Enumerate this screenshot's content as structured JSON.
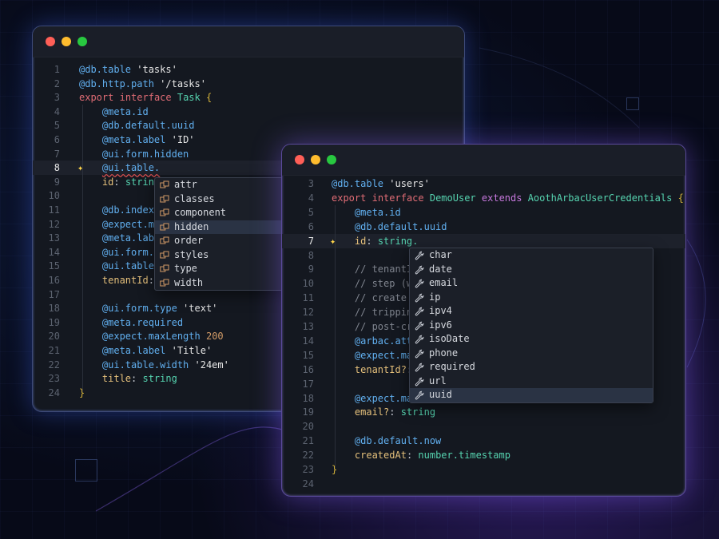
{
  "window1": {
    "lines": [
      {
        "n": "1",
        "segs": [
          [
            "dec",
            "@db.table"
          ],
          [
            "str",
            " 'tasks'"
          ]
        ]
      },
      {
        "n": "2",
        "segs": [
          [
            "dec",
            "@db.http.path"
          ],
          [
            "str",
            " '/tasks'"
          ]
        ]
      },
      {
        "n": "3",
        "segs": [
          [
            "kw",
            "export"
          ],
          [
            "pl",
            " "
          ],
          [
            "kw",
            "interface"
          ],
          [
            "pl",
            " "
          ],
          [
            "t",
            "Task"
          ],
          [
            "pl",
            " "
          ],
          [
            "br",
            "{"
          ]
        ]
      },
      {
        "n": "4",
        "segs": [
          [
            "pl",
            "    "
          ],
          [
            "dec",
            "@meta.id"
          ]
        ]
      },
      {
        "n": "5",
        "segs": [
          [
            "pl",
            "    "
          ],
          [
            "dec",
            "@db.default.uuid"
          ]
        ]
      },
      {
        "n": "6",
        "segs": [
          [
            "pl",
            "    "
          ],
          [
            "dec",
            "@meta.label"
          ],
          [
            "str",
            " 'ID'"
          ]
        ]
      },
      {
        "n": "7",
        "segs": [
          [
            "pl",
            "    "
          ],
          [
            "dec",
            "@ui.form.hidden"
          ]
        ]
      },
      {
        "n": "8",
        "cur": true,
        "spark": true,
        "segs": [
          [
            "pl",
            "    "
          ],
          [
            "dec squig",
            "@ui.table."
          ]
        ]
      },
      {
        "n": "9",
        "segs": [
          [
            "pl",
            "    "
          ],
          [
            "prop",
            "id"
          ],
          [
            "pl",
            ": "
          ],
          [
            "t",
            "string"
          ]
        ]
      },
      {
        "n": "10",
        "segs": []
      },
      {
        "n": "11",
        "segs": [
          [
            "pl",
            "    "
          ],
          [
            "dec",
            "@db.index.unique"
          ]
        ]
      },
      {
        "n": "12",
        "segs": [
          [
            "pl",
            "    "
          ],
          [
            "dec",
            "@expect.maxLength"
          ]
        ]
      },
      {
        "n": "13",
        "segs": [
          [
            "pl",
            "    "
          ],
          [
            "dec",
            "@meta.label"
          ]
        ]
      },
      {
        "n": "14",
        "segs": [
          [
            "pl",
            "    "
          ],
          [
            "dec",
            "@ui.form.hidden"
          ]
        ]
      },
      {
        "n": "15",
        "segs": [
          [
            "pl",
            "    "
          ],
          [
            "dec",
            "@ui.table.hidden"
          ]
        ]
      },
      {
        "n": "16",
        "segs": [
          [
            "pl",
            "    "
          ],
          [
            "prop",
            "tenantId"
          ],
          [
            "pl",
            ": "
          ],
          [
            "t",
            "string"
          ]
        ]
      },
      {
        "n": "17",
        "segs": []
      },
      {
        "n": "18",
        "segs": [
          [
            "pl",
            "    "
          ],
          [
            "dec",
            "@ui.form.type"
          ],
          [
            "str",
            " 'text'"
          ]
        ]
      },
      {
        "n": "19",
        "segs": [
          [
            "pl",
            "    "
          ],
          [
            "dec",
            "@meta.required"
          ]
        ]
      },
      {
        "n": "20",
        "segs": [
          [
            "pl",
            "    "
          ],
          [
            "dec",
            "@expect.maxLength"
          ],
          [
            "pl",
            " "
          ],
          [
            "num",
            "200"
          ]
        ]
      },
      {
        "n": "21",
        "segs": [
          [
            "pl",
            "    "
          ],
          [
            "dec",
            "@meta.label"
          ],
          [
            "str",
            " 'Title'"
          ]
        ]
      },
      {
        "n": "22",
        "segs": [
          [
            "pl",
            "    "
          ],
          [
            "dec",
            "@ui.table.width"
          ],
          [
            "str",
            " '24em'"
          ]
        ]
      },
      {
        "n": "23",
        "segs": [
          [
            "pl",
            "    "
          ],
          [
            "prop",
            "title"
          ],
          [
            "pl",
            ": "
          ],
          [
            "t",
            "string"
          ]
        ]
      },
      {
        "n": "24",
        "segs": [
          [
            "br",
            "}"
          ]
        ]
      }
    ],
    "autocomplete": {
      "icon": "symbol-method-icon",
      "items": [
        "attr",
        "classes",
        "component",
        "hidden",
        "order",
        "styles",
        "type",
        "width"
      ],
      "selected": 3
    }
  },
  "window2": {
    "lines": [
      {
        "n": "3",
        "segs": [
          [
            "dec",
            "@db.table"
          ],
          [
            "str",
            " 'users'"
          ]
        ]
      },
      {
        "n": "4",
        "segs": [
          [
            "kw",
            "export"
          ],
          [
            "pl",
            " "
          ],
          [
            "kw",
            "interface"
          ],
          [
            "pl",
            " "
          ],
          [
            "t",
            "DemoUser"
          ],
          [
            "pl",
            " "
          ],
          [
            "kw2",
            "extends"
          ],
          [
            "pl",
            " "
          ],
          [
            "t",
            "AoothArbacUserCredentials"
          ],
          [
            "pl",
            " "
          ],
          [
            "br",
            "{"
          ]
        ]
      },
      {
        "n": "5",
        "segs": [
          [
            "pl",
            "    "
          ],
          [
            "dec",
            "@meta.id"
          ]
        ]
      },
      {
        "n": "6",
        "segs": [
          [
            "pl",
            "    "
          ],
          [
            "dec",
            "@db.default.uuid"
          ]
        ]
      },
      {
        "n": "7",
        "cur": true,
        "spark": true,
        "segs": [
          [
            "pl",
            "    "
          ],
          [
            "prop",
            "id"
          ],
          [
            "pl",
            ": "
          ],
          [
            "t",
            "string."
          ]
        ]
      },
      {
        "n": "8",
        "segs": []
      },
      {
        "n": "9",
        "segs": [
          [
            "pl",
            "    "
          ],
          [
            "cm",
            "// tenantId"
          ]
        ]
      },
      {
        "n": "10",
        "segs": [
          [
            "pl",
            "    "
          ],
          [
            "cm",
            "// step (wh"
          ]
        ]
      },
      {
        "n": "11",
        "segs": [
          [
            "pl",
            "    "
          ],
          [
            "cm",
            "// create r"
          ]
        ]
      },
      {
        "n": "12",
        "segs": [
          [
            "pl",
            "    "
          ],
          [
            "cm",
            "// tripping"
          ]
        ]
      },
      {
        "n": "13",
        "segs": [
          [
            "pl",
            "    "
          ],
          [
            "cm",
            "// post-cre"
          ]
        ]
      },
      {
        "n": "14",
        "segs": [
          [
            "pl",
            "    "
          ],
          [
            "dec",
            "@arbac.attr"
          ]
        ]
      },
      {
        "n": "15",
        "segs": [
          [
            "pl",
            "    "
          ],
          [
            "dec",
            "@expect.max"
          ]
        ]
      },
      {
        "n": "16",
        "segs": [
          [
            "pl",
            "    "
          ],
          [
            "prop",
            "tenantId?"
          ],
          [
            "pl",
            ": "
          ]
        ]
      },
      {
        "n": "17",
        "segs": []
      },
      {
        "n": "18",
        "segs": [
          [
            "pl",
            "    "
          ],
          [
            "dec",
            "@expect.max"
          ]
        ]
      },
      {
        "n": "19",
        "segs": [
          [
            "pl",
            "    "
          ],
          [
            "prop",
            "email?"
          ],
          [
            "pl",
            ": "
          ],
          [
            "t",
            "string"
          ]
        ]
      },
      {
        "n": "20",
        "segs": []
      },
      {
        "n": "21",
        "segs": [
          [
            "pl",
            "    "
          ],
          [
            "dec",
            "@db.default.now"
          ]
        ]
      },
      {
        "n": "22",
        "segs": [
          [
            "pl",
            "    "
          ],
          [
            "prop",
            "createdAt"
          ],
          [
            "pl",
            ": "
          ],
          [
            "t",
            "number.timestamp"
          ]
        ]
      },
      {
        "n": "23",
        "segs": [
          [
            "br",
            "}"
          ]
        ]
      },
      {
        "n": "24",
        "segs": []
      }
    ],
    "autocomplete": {
      "icon": "wrench-icon",
      "items": [
        "char",
        "date",
        "email",
        "ip",
        "ipv4",
        "ipv6",
        "isoDate",
        "phone",
        "required",
        "url",
        "uuid"
      ],
      "selected": 10
    }
  },
  "colors": {
    "accent_blue": "#61afef",
    "accent_red": "#e06c75",
    "type_green": "#56d4b0",
    "number_orange": "#d19a66"
  }
}
